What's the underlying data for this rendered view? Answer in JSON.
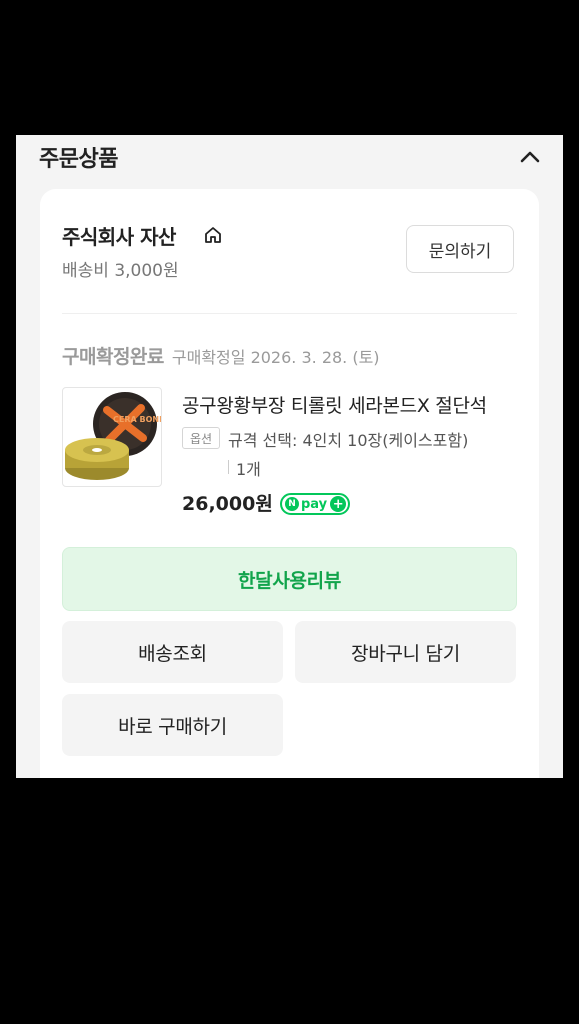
{
  "section": {
    "title": "주문상품",
    "collapse_icon": "chevron-up-icon"
  },
  "seller": {
    "name": "주식회사 자산",
    "icon": "home-icon",
    "shipping_fee": "배송비 3,000원",
    "inquiry_label": "문의하기"
  },
  "order": {
    "status": "구매확정완료",
    "status_date": "구매확정일 2026. 3. 28. (토)",
    "product_name": "공구왕황부장 티롤릿 세라본드X 절단석",
    "option_badge": "옵션",
    "option_text": "규격 선택: 4인치 10장(케이스포함)",
    "quantity": "1개",
    "price": "26,000원",
    "pay_badge": {
      "text": "pay",
      "icon_letter": "N",
      "plus": "+"
    },
    "thumbnail_label": "CERA BOND"
  },
  "actions": {
    "review": "한달사용리뷰",
    "track": "배송조회",
    "cart": "장바구니 담기",
    "buy_now": "바로 구매하기"
  },
  "colors": {
    "accent_green": "#03c75a",
    "review_bg": "#e3f7e7",
    "review_text": "#11a44b"
  }
}
